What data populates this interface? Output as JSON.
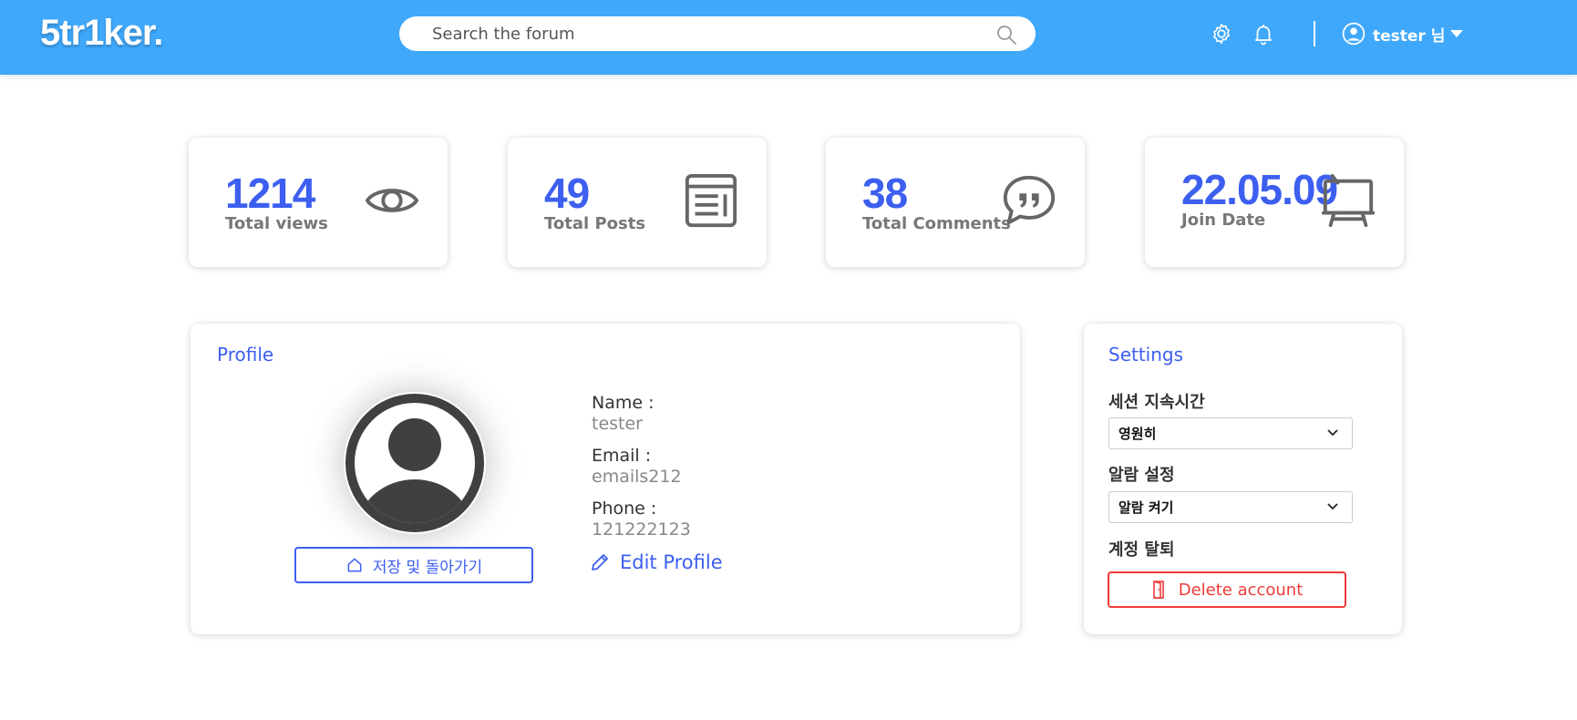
{
  "header": {
    "logo": "5tr1ker.",
    "search_placeholder": "Search the forum",
    "user_label": "tester 님"
  },
  "stats": [
    {
      "value": "1214",
      "label": "Total views",
      "icon": "eye-icon"
    },
    {
      "value": "49",
      "label": "Total Posts",
      "icon": "newspaper-icon"
    },
    {
      "value": "38",
      "label": "Total Comments",
      "icon": "quote-bubble-icon"
    },
    {
      "value": "22.05.09",
      "label": "Join Date",
      "icon": "easel-icon"
    }
  ],
  "profile": {
    "title": "Profile",
    "name_label": "Name :",
    "name_value": "tester",
    "email_label": "Email :",
    "email_value": "emails212",
    "phone_label": "Phone :",
    "phone_value": "121222123",
    "save_button": "저장 및 돌아가기",
    "edit_link": "Edit Profile"
  },
  "settings": {
    "title": "Settings",
    "session_label": "세션 지속시간",
    "session_value": "영원히",
    "alarm_label": "알람 설정",
    "alarm_value": "알람 켜기",
    "delete_section_label": "계정 탈퇴",
    "delete_button": "Delete account"
  },
  "colors": {
    "header_bg": "#3fa8fb",
    "accent": "#3d5ff0",
    "danger": "#f03a3a"
  }
}
